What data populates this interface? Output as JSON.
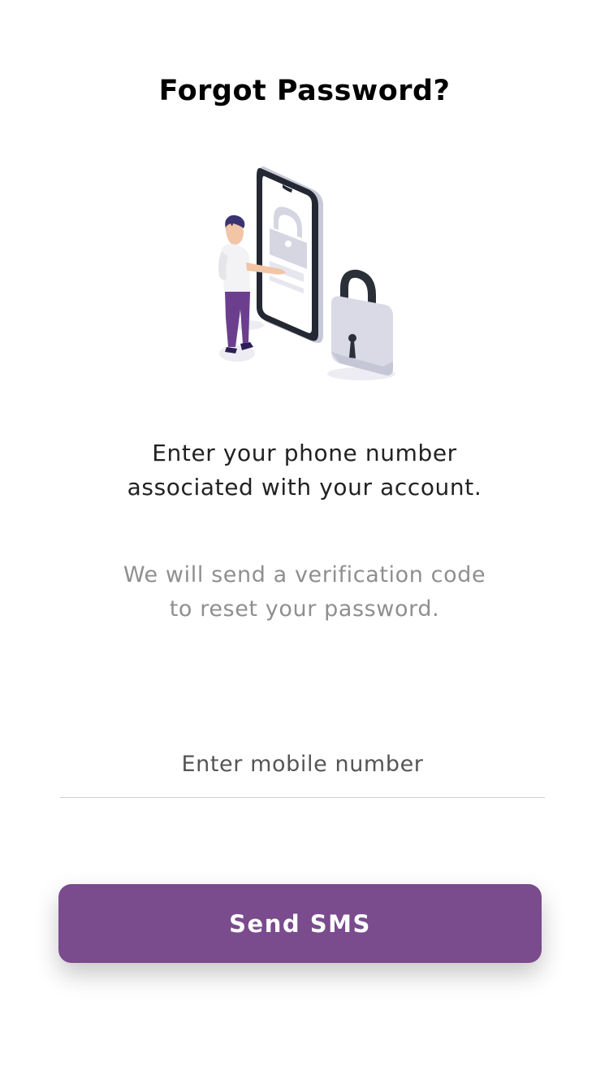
{
  "page": {
    "title": "Forgot Password?"
  },
  "illustration": {
    "icon": "person-phone-padlock-illustration"
  },
  "instructions": {
    "line1": "Enter your phone number",
    "line2": "associated with your account."
  },
  "note": {
    "line1": "We will send a verification code",
    "line2": "to reset your password."
  },
  "form": {
    "mobile_placeholder": "Enter mobile number",
    "mobile_value": ""
  },
  "actions": {
    "send_label": "Send SMS"
  },
  "colors": {
    "accent": "#7a4b8d",
    "illustration_gray": "#dcdce6",
    "illustration_dark": "#2b2f38",
    "person_shirt": "#f3f3f6",
    "person_pants": "#6c3f8e",
    "person_hair": "#3a3372"
  }
}
